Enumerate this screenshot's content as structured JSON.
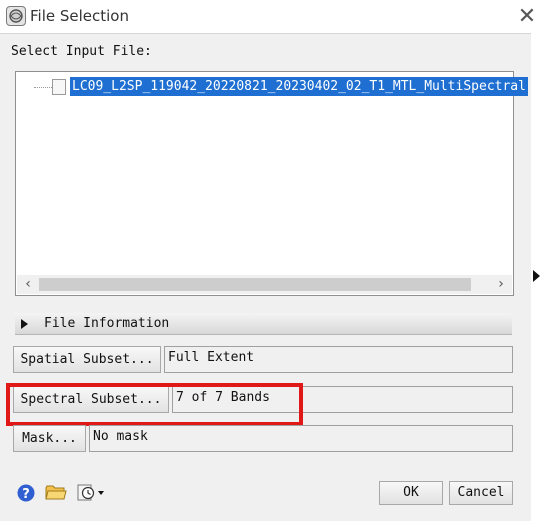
{
  "window": {
    "title": "File Selection",
    "close_icon": "close-icon"
  },
  "input": {
    "label": "Select Input File:",
    "files": [
      {
        "name": "LC09_L2SP_119042_20220821_20230402_02_T1_MTL_MultiSpectral",
        "selected": true
      }
    ]
  },
  "file_information": {
    "label": "File Information",
    "expanded": false
  },
  "spatial_subset": {
    "button_label": "Spatial Subset...",
    "value": "Full Extent"
  },
  "spectral_subset": {
    "button_label": "Spectral Subset...",
    "value": "7 of 7 Bands",
    "highlight_color": "#e01818"
  },
  "mask": {
    "button_label": "Mask...",
    "value": "No mask"
  },
  "footer": {
    "ok_label": "OK",
    "cancel_label": "Cancel",
    "icons": [
      "help-icon",
      "open-folder-icon",
      "history-icon"
    ]
  },
  "colors": {
    "selection": "#1e6fd1",
    "dialog_bg": "#f0f0f0"
  }
}
